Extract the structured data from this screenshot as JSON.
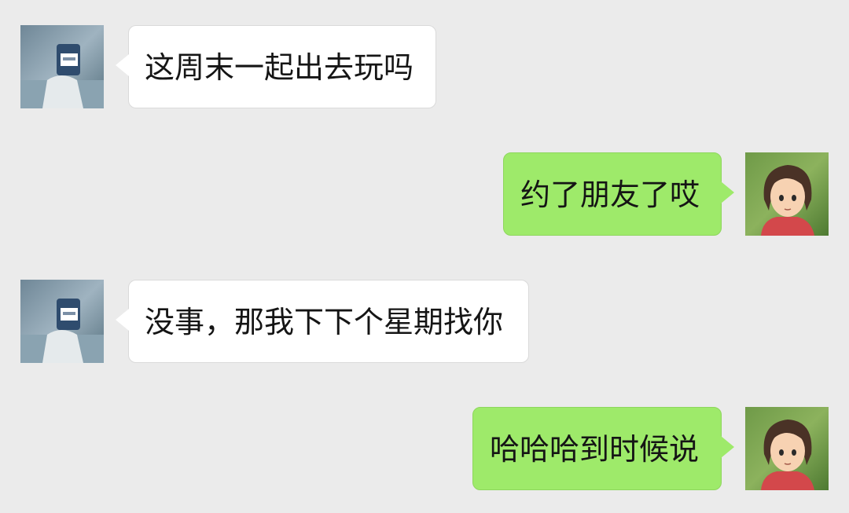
{
  "chat": {
    "messages": [
      {
        "side": "incoming",
        "sender": "friend-avatar",
        "text": "这周末一起出去玩吗"
      },
      {
        "side": "outgoing",
        "sender": "self-avatar",
        "text": "约了朋友了哎"
      },
      {
        "side": "incoming",
        "sender": "friend-avatar",
        "text": "没事，那我下下个星期找你"
      },
      {
        "side": "outgoing",
        "sender": "self-avatar",
        "text": "哈哈哈到时候说"
      }
    ]
  },
  "colors": {
    "background": "#ebebeb",
    "incoming_bubble": "#ffffff",
    "outgoing_bubble": "#9eea6a",
    "text": "#151515"
  }
}
